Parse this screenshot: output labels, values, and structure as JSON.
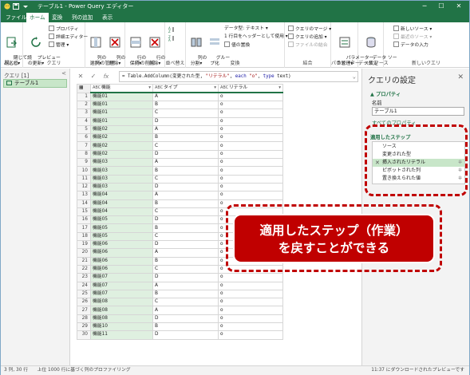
{
  "titlebar": {
    "title": "テーブル1 - Power Query エディター",
    "controls": {
      "minimize": "─",
      "maximize": "☐",
      "close": "✕"
    }
  },
  "ribbon_tabs": [
    {
      "label": "ファイル",
      "active": false
    },
    {
      "label": "ホーム",
      "active": true
    },
    {
      "label": "変換",
      "active": false
    },
    {
      "label": "列の追加",
      "active": false
    },
    {
      "label": "表示",
      "active": false
    }
  ],
  "ribbon": {
    "close_group": {
      "button": "閉じて読\nみ込む▾",
      "label": "閉じる"
    },
    "query_group": {
      "preview_button": "プレビュー\nの更新▾",
      "properties": "プロパティ",
      "advanced_editor": "詳細エディター",
      "manage": "管理 ▾",
      "label": "クエリ"
    },
    "columns_group": {
      "choose": "列の\n選択▾",
      "remove": "列の\n削除▾",
      "label": "列の管理"
    },
    "rows_group": {
      "keep": "行の\n保持▾",
      "remove": "行の\n削除▾",
      "label": "行の削減"
    },
    "sort_group": {
      "label": "並べ替え"
    },
    "transform_group": {
      "split": "列の\n分割▾",
      "groupby": "グルー\nプ化",
      "datatype": "データ型: テキスト ▾",
      "first_row_header": "1 行目をヘッダーとして使用 ▾",
      "replace_values": "値の置換",
      "label": "変換"
    },
    "combine_group": {
      "merge": "クエリのマージ ▾",
      "append": "クエリの追加 ▾",
      "combine_files": "ファイルの結合",
      "label": "結合"
    },
    "parameters_group": {
      "button": "パラメーター\nの管理▾",
      "label": "パラメーター"
    },
    "datasource_group": {
      "button": "データ ソー\nス設定",
      "label": "データ ソース"
    },
    "newquery_group": {
      "new_source": "新しいソース ▾",
      "recent_sources": "最近のソース ▾",
      "enter_data": "データの入力",
      "label": "新しいクエリ"
    }
  },
  "queries_pane": {
    "header": "クエリ [1]",
    "items": [
      {
        "label": "テーブル1"
      }
    ]
  },
  "formula_bar": {
    "prefix": "= Table.AddColumn(変更された型, ",
    "string1": "\"リテラル\"",
    "mid1": ", ",
    "kw1": "each",
    "string2": " \"o\"",
    "mid2": ", ",
    "kw2": "type",
    "suffix": " text)"
  },
  "grid": {
    "columns": [
      {
        "type": "ABC",
        "name": "機能"
      },
      {
        "type": "ABC",
        "name": "タイプ"
      },
      {
        "type": "ABC",
        "name": "リテラル"
      }
    ],
    "rows": [
      [
        "機能01",
        "A",
        "o"
      ],
      [
        "機能01",
        "B",
        "o"
      ],
      [
        "機能01",
        "C",
        "o"
      ],
      [
        "機能01",
        "D",
        "o"
      ],
      [
        "機能02",
        "A",
        "o"
      ],
      [
        "機能02",
        "B",
        "o"
      ],
      [
        "機能02",
        "C",
        "o"
      ],
      [
        "機能02",
        "D",
        "o"
      ],
      [
        "機能03",
        "A",
        "o"
      ],
      [
        "機能03",
        "B",
        "o"
      ],
      [
        "機能03",
        "C",
        "o"
      ],
      [
        "機能03",
        "D",
        "o"
      ],
      [
        "機能04",
        "A",
        "o"
      ],
      [
        "機能04",
        "B",
        "o"
      ],
      [
        "機能04",
        "C",
        "o"
      ],
      [
        "機能05",
        "D",
        "o"
      ],
      [
        "機能05",
        "B",
        "o"
      ],
      [
        "機能05",
        "C",
        "o"
      ],
      [
        "機能06",
        "D",
        "o"
      ],
      [
        "機能06",
        "A",
        "o"
      ],
      [
        "機能06",
        "B",
        "o"
      ],
      [
        "機能06",
        "C",
        "o"
      ],
      [
        "機能07",
        "D",
        "o"
      ],
      [
        "機能07",
        "A",
        "o"
      ],
      [
        "機能07",
        "B",
        "o"
      ],
      [
        "機能08",
        "C",
        "o"
      ],
      [
        "機能08",
        "A",
        "o"
      ],
      [
        "機能08",
        "D",
        "o"
      ],
      [
        "機能10",
        "B",
        "o"
      ],
      [
        "機能11",
        "D",
        "o"
      ]
    ]
  },
  "settings_pane": {
    "title": "クエリの設定",
    "properties_section": "▲ プロパティ",
    "name_label": "名前",
    "name_value": "テーブル1",
    "all_properties_link": "すべてのプロパティ",
    "steps_section": "適用したステップ",
    "steps": [
      {
        "label": "ソース",
        "selected": false,
        "gear": false
      },
      {
        "label": "変更された型",
        "selected": false,
        "gear": false
      },
      {
        "label": "挿入されたリテラル",
        "selected": true,
        "gear": true
      },
      {
        "label": "ピボットされた列",
        "selected": false,
        "gear": true
      },
      {
        "label": "置き換えられた値",
        "selected": false,
        "gear": true
      }
    ]
  },
  "status_bar": {
    "left": "3 列, 30 行　　上位 1000 行に基づく列のプロファイリング",
    "right": "11:37 にダウンロードされたプレビューです"
  },
  "annotation": {
    "line1": "適用したステップ（作業）",
    "line2": "を戻すことができる",
    "color": "#c00000"
  },
  "colors": {
    "accent": "#217346",
    "selection": "#c8e6c9"
  }
}
